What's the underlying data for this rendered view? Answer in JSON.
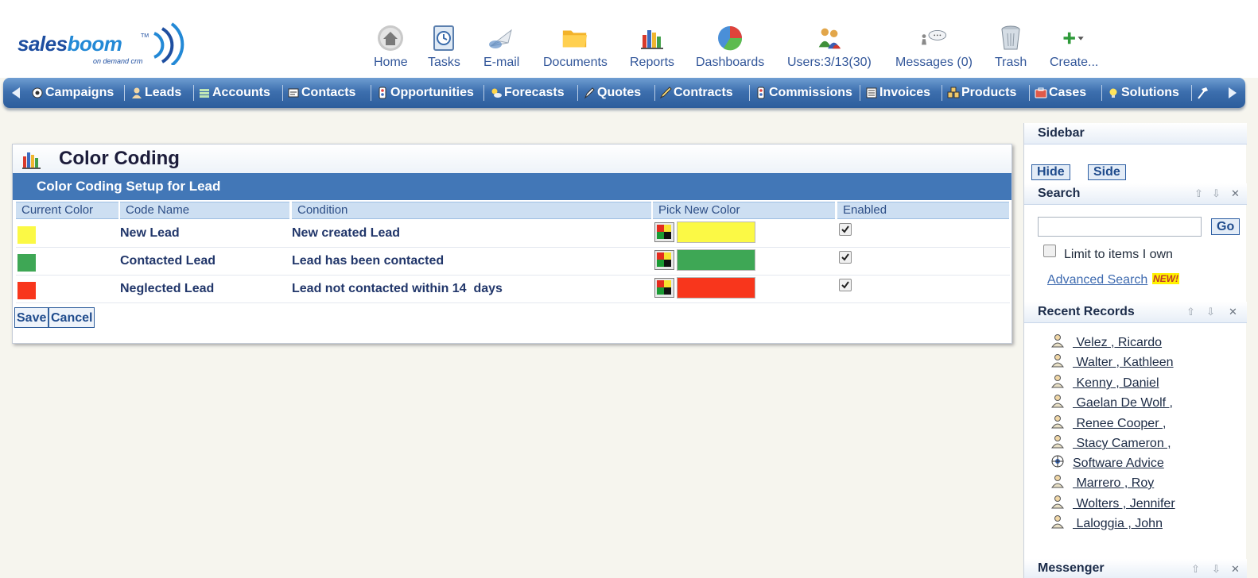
{
  "brand": {
    "wordmark_a": "sales",
    "wordmark_b": "boom",
    "tagline": "on demand crm",
    "trademark": "TM"
  },
  "topnav": [
    {
      "id": "home",
      "label": "Home",
      "icon": "home-icon"
    },
    {
      "id": "tasks",
      "label": "Tasks",
      "icon": "tasks-icon"
    },
    {
      "id": "email",
      "label": "E-mail",
      "icon": "email-icon"
    },
    {
      "id": "documents",
      "label": "Documents",
      "icon": "folder-icon"
    },
    {
      "id": "reports",
      "label": "Reports",
      "icon": "reports-icon"
    },
    {
      "id": "dashboards",
      "label": "Dashboards",
      "icon": "dashboards-icon"
    },
    {
      "id": "users",
      "label": "Users:3/13(30)",
      "icon": "users-icon"
    },
    {
      "id": "messages",
      "label": "Messages (0)",
      "icon": "messages-icon"
    },
    {
      "id": "trash",
      "label": "Trash",
      "icon": "trash-icon"
    },
    {
      "id": "create",
      "label": "Create...",
      "icon": "plus-icon"
    }
  ],
  "tabs": [
    {
      "label": "Campaigns",
      "icon": "campaigns-icon"
    },
    {
      "label": "Leads",
      "icon": "leads-icon"
    },
    {
      "label": "Accounts",
      "icon": "accounts-icon"
    },
    {
      "label": "Contacts",
      "icon": "contacts-icon"
    },
    {
      "label": "Opportunities",
      "icon": "opportunities-icon"
    },
    {
      "label": "Forecasts",
      "icon": "forecasts-icon"
    },
    {
      "label": "Quotes",
      "icon": "quotes-icon"
    },
    {
      "label": "Contracts",
      "icon": "contracts-icon"
    },
    {
      "label": "Commissions",
      "icon": "commissions-icon"
    },
    {
      "label": "Invoices",
      "icon": "invoices-icon"
    },
    {
      "label": "Products",
      "icon": "products-icon"
    },
    {
      "label": "Cases",
      "icon": "cases-icon"
    },
    {
      "label": "Solutions",
      "icon": "solutions-icon"
    }
  ],
  "panel": {
    "title": "Color Coding",
    "subtitle": "Color Coding Setup for Lead",
    "columns": [
      "Current Color",
      "Code Name",
      "Condition",
      "Pick New Color",
      "Enabled"
    ],
    "rows": [
      {
        "color": "#fbf945",
        "code_name": "New Lead",
        "condition": "New created Lead",
        "enabled": true
      },
      {
        "color": "#3ea755",
        "code_name": "Contacted Lead",
        "condition": "Lead has been contacted",
        "enabled": true
      },
      {
        "color": "#f8361c",
        "code_name": "Neglected Lead",
        "condition": "Lead not contacted within 14  days",
        "enabled": true
      }
    ],
    "save_label": "Save",
    "cancel_label": "Cancel"
  },
  "sidebar": {
    "title": "Sidebar",
    "hide_label": "Hide",
    "side_label": "Side",
    "search": {
      "title": "Search",
      "input_value": "",
      "go_label": "Go",
      "limit_label": "Limit to items I own",
      "advanced_label": "Advanced Search",
      "new_badge": "NEW!"
    },
    "recent": {
      "title": "Recent Records",
      "items": [
        {
          "label": " Velez , Ricardo",
          "icon": "person-icon"
        },
        {
          "label": " Walter , Kathleen",
          "icon": "person-icon"
        },
        {
          "label": " Kenny , Daniel",
          "icon": "person-icon"
        },
        {
          "label": " Gaelan De Wolf ,",
          "icon": "person-icon"
        },
        {
          "label": " Renee Cooper ,",
          "icon": "person-icon"
        },
        {
          "label": " Stacy Cameron ,",
          "icon": "person-icon"
        },
        {
          "label": "Software Advice",
          "icon": "campaign-icon"
        },
        {
          "label": " Marrero , Roy",
          "icon": "person-icon"
        },
        {
          "label": " Wolters , Jennifer",
          "icon": "person-icon"
        },
        {
          "label": " Laloggia , John",
          "icon": "person-icon"
        }
      ]
    },
    "messenger_title": "Messenger"
  },
  "colors": {
    "nav_blue": "#3d6fae",
    "subhead_blue": "#4277b7",
    "link_blue": "#33579a"
  }
}
